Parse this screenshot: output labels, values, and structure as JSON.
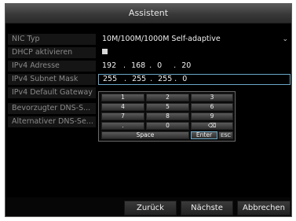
{
  "window": {
    "title": "Assistent"
  },
  "form": {
    "nic_type": {
      "label": "NIC Typ",
      "value": "10M/100M/1000M Self-adaptive",
      "chevron": "⌄"
    },
    "dhcp": {
      "label": "DHCP aktivieren",
      "checked": false
    },
    "ipv4_address": {
      "label": "IPv4 Adresse",
      "octets": [
        "192",
        "168",
        "0",
        "20"
      ]
    },
    "subnet_mask": {
      "label": "IPv4 Subnet Mask",
      "octets": [
        "255",
        "255",
        "255",
        "0"
      ]
    },
    "gateway": {
      "label": "IPv4 Default Gateway"
    },
    "dns_preferred": {
      "label": "Bevorzugter DNS-S..."
    },
    "dns_alternate": {
      "label": "Alternativer DNS-Se..."
    }
  },
  "keyboard": {
    "keys": [
      [
        "1",
        "2",
        "3"
      ],
      [
        "4",
        "5",
        "6"
      ],
      [
        "7",
        "8",
        "9"
      ],
      [
        ".",
        "0",
        "⌫"
      ]
    ],
    "space": "Space",
    "enter": "Enter",
    "esc": "ESC"
  },
  "buttons": {
    "back": "Zurück",
    "next": "Nächste",
    "cancel": "Abbrechen"
  },
  "colors": {
    "highlight_border": "#6aa7c7",
    "background": "#000000"
  }
}
